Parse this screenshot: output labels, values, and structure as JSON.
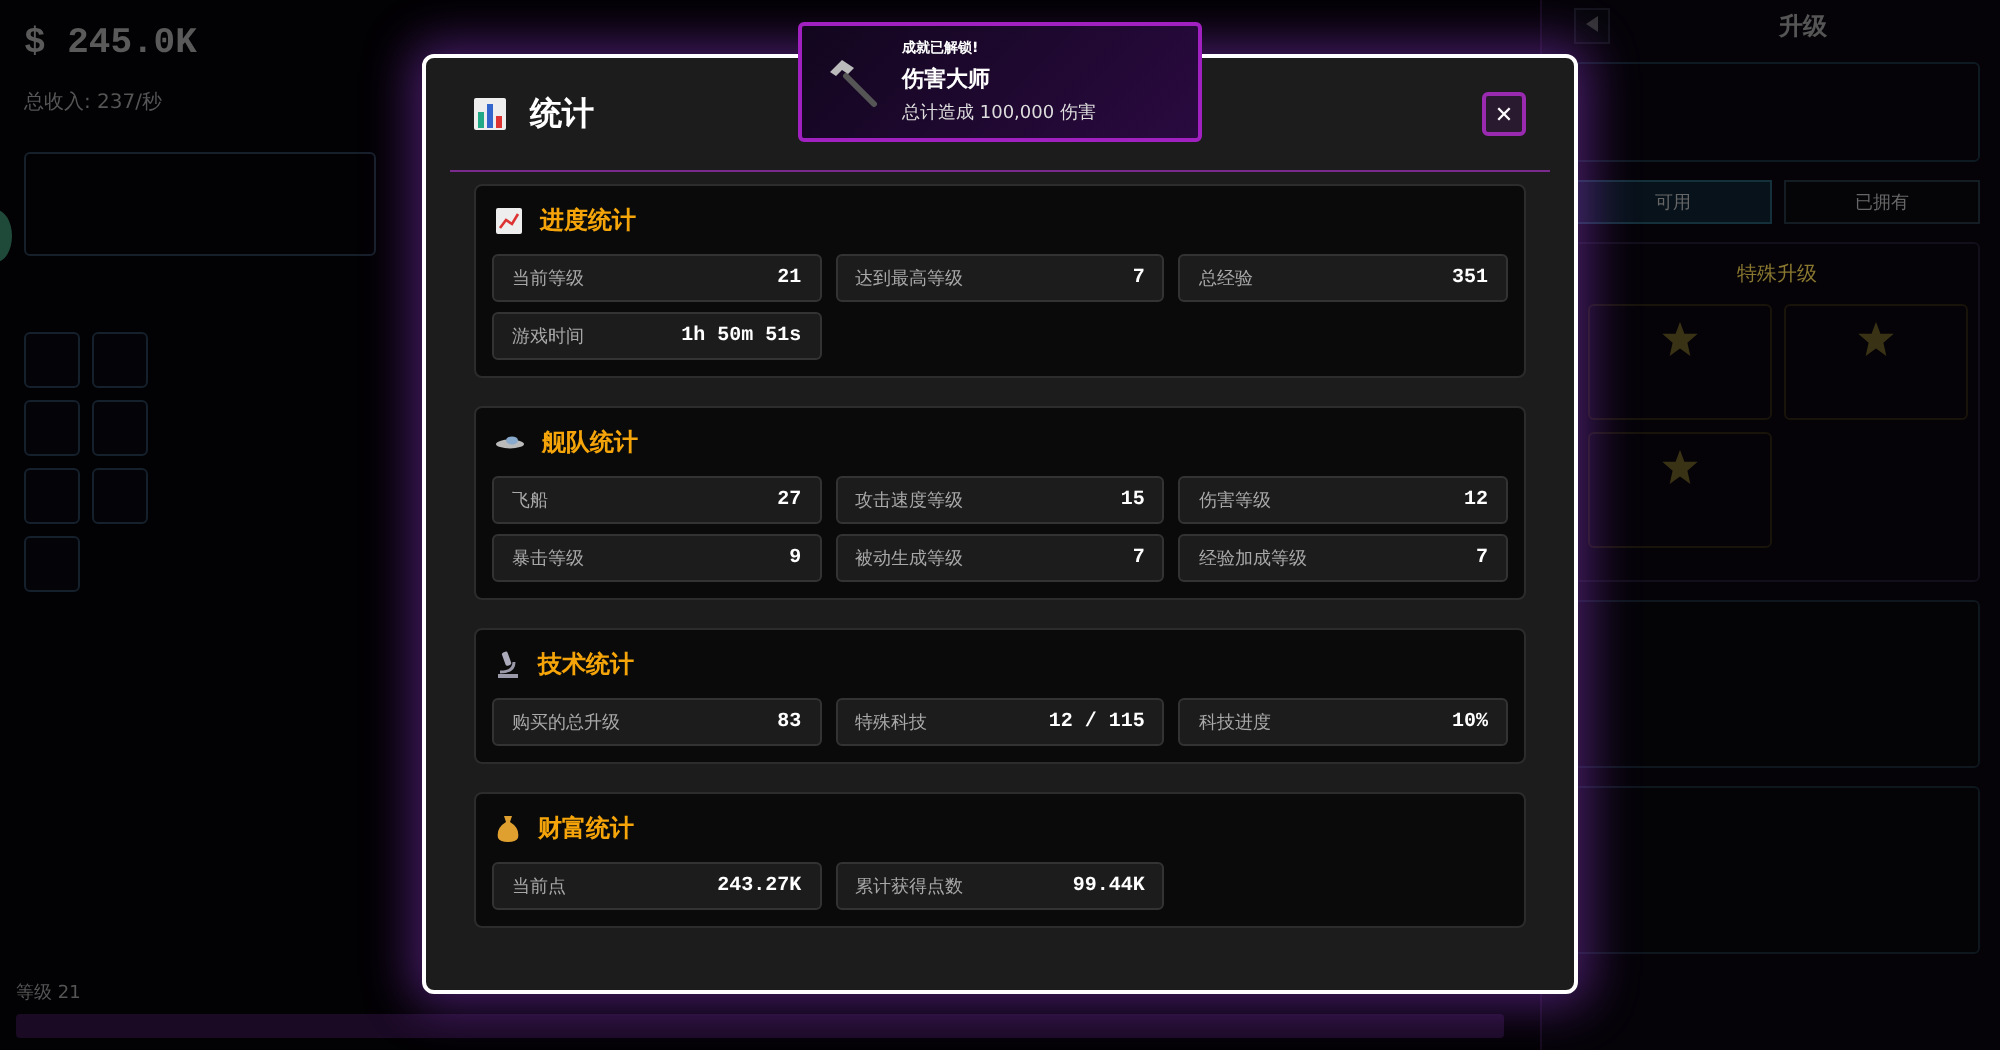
{
  "background": {
    "money": "$ 245.0K",
    "income": "总收入: 237/秒",
    "panel_title": "升级",
    "tabs": [
      {
        "label": "可用",
        "selected": true
      },
      {
        "label": "已拥有",
        "selected": false
      }
    ],
    "special_title": "特殊升级",
    "level_label": "等级 21"
  },
  "toast": {
    "heading": "成就已解锁!",
    "title": "伤害大师",
    "description": "总计造成 100,000 伤害"
  },
  "modal": {
    "title": "统计",
    "close": "✕",
    "sections": [
      {
        "title": "进度统计",
        "kind": "chart",
        "stats": [
          {
            "label": "当前等级",
            "value": "21"
          },
          {
            "label": "达到最高等级",
            "value": "7"
          },
          {
            "label": "总经验",
            "value": "351"
          },
          {
            "label": "游戏时间",
            "value": "1h 50m 51s"
          }
        ]
      },
      {
        "title": "舰队统计",
        "kind": "ufo",
        "stats": [
          {
            "label": "飞船",
            "value": "27"
          },
          {
            "label": "攻击速度等级",
            "value": "15"
          },
          {
            "label": "伤害等级",
            "value": "12"
          },
          {
            "label": "暴击等级",
            "value": "9"
          },
          {
            "label": "被动生成等级",
            "value": "7"
          },
          {
            "label": "经验加成等级",
            "value": "7"
          }
        ]
      },
      {
        "title": "技术统计",
        "kind": "microscope",
        "stats": [
          {
            "label": "购买的总升级",
            "value": "83"
          },
          {
            "label": "特殊科技",
            "value": "12 / 115"
          },
          {
            "label": "科技进度",
            "value": "10%"
          }
        ]
      },
      {
        "title": "财富统计",
        "kind": "moneybag",
        "stats": [
          {
            "label": "当前点",
            "value": "243.27K"
          },
          {
            "label": "累计获得点数",
            "value": "99.44K"
          }
        ]
      }
    ]
  }
}
